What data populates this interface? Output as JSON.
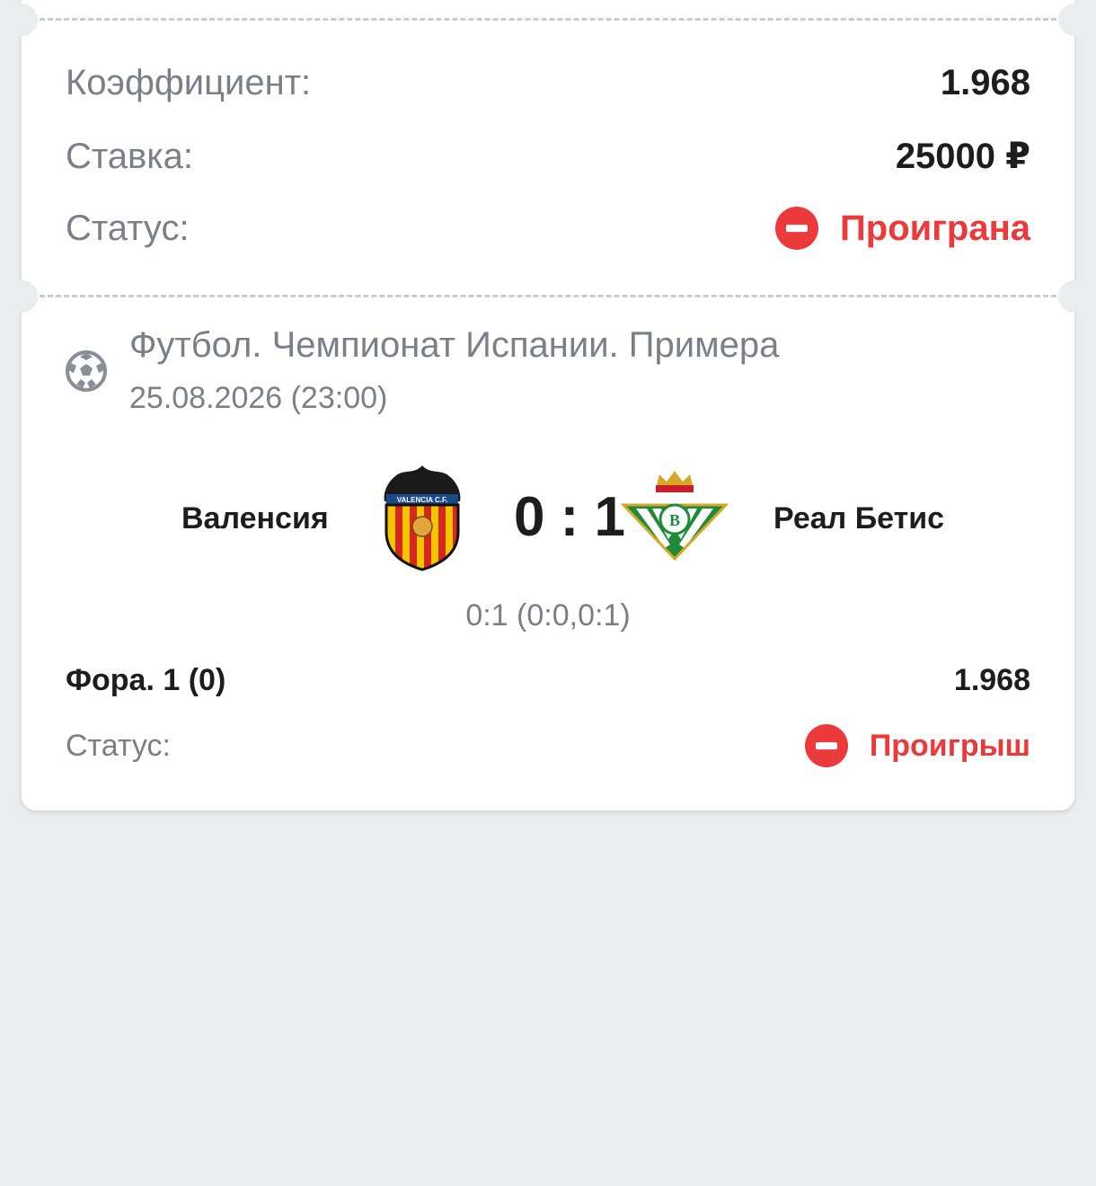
{
  "summary": {
    "coef_label": "Коэффициент:",
    "coef_value": "1.968",
    "stake_label": "Ставка:",
    "stake_value": "25000 ₽",
    "status_label": "Статус:",
    "status_value": "Проиграна"
  },
  "event": {
    "sport_icon": "soccer-ball-icon",
    "league": "Футбол. Чемпионат Испании. Примера",
    "date": "25.08.2026 (23:00)",
    "home_team": "Валенсия",
    "away_team": "Реал Бетис",
    "score": "0 : 1",
    "score_detail": "0:1 (0:0,0:1)",
    "market_label": "Фора. 1 (0)",
    "market_coef": "1.968",
    "status_label": "Статус:",
    "status_value": "Проигрыш"
  },
  "colors": {
    "loss": "#ec3a3a",
    "background": "#ebecee",
    "muted_text": "#7a7f88"
  }
}
